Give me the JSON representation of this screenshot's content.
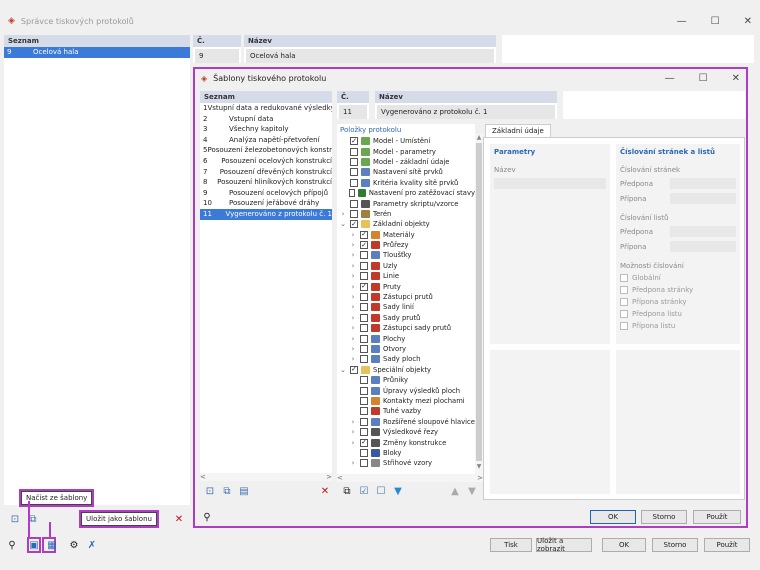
{
  "outer": {
    "title": "Správce tiskových protokolů",
    "list_header": "Seznam",
    "list_items": [
      {
        "num": "9",
        "name": "Ocelová hala"
      }
    ],
    "c_header": "Č.",
    "c_value": "9",
    "name_header": "Název",
    "name_value": "Ocelová hala",
    "buttons": {
      "print": "Tisk",
      "show": "Uložit a zobrazit",
      "ok": "OK",
      "cancel": "Storno",
      "apply": "Použít"
    }
  },
  "tooltips": {
    "load": "Načíst ze šablony",
    "save": "Uložit jako šablonu"
  },
  "inner": {
    "title": "Šablony tiskového protokolu",
    "list_header": "Seznam",
    "list_items": [
      {
        "num": "1",
        "name": "Vstupní data a redukované výsledky"
      },
      {
        "num": "2",
        "name": "Vstupní data"
      },
      {
        "num": "3",
        "name": "Všechny kapitoly"
      },
      {
        "num": "4",
        "name": "Analýza napětí-přetvoření"
      },
      {
        "num": "5",
        "name": "Posouzení železobetonových konstrukcí"
      },
      {
        "num": "6",
        "name": "Posouzení ocelových konstrukcí"
      },
      {
        "num": "7",
        "name": "Posouzení dřevěných konstrukcí"
      },
      {
        "num": "8",
        "name": "Posouzení hliníkových konstrukcí"
      },
      {
        "num": "9",
        "name": "Posouzení ocelových přípojů"
      },
      {
        "num": "10",
        "name": "Posouzení jeřábové dráhy"
      },
      {
        "num": "11",
        "name": "Vygenerováno z protokolu č. 1"
      }
    ],
    "c_header": "Č.",
    "c_value": "11",
    "name_header": "Název",
    "name_value": "Vygenerováno z protokolu č. 1",
    "items_header": "Položky protokolu",
    "tree": [
      {
        "indent": 1,
        "exp": "",
        "checked": true,
        "icon": "model-icon",
        "color": "#6aa84f",
        "label": "Model - Umístění"
      },
      {
        "indent": 1,
        "exp": "",
        "checked": false,
        "icon": "model-params-icon",
        "color": "#6aa84f",
        "label": "Model - parametry"
      },
      {
        "indent": 1,
        "exp": "",
        "checked": false,
        "icon": "model-basic-icon",
        "color": "#6aa84f",
        "label": "Model - základní údaje"
      },
      {
        "indent": 1,
        "exp": "",
        "checked": false,
        "icon": "mesh-settings-icon",
        "color": "#5b7fbf",
        "label": "Nastavení sítě prvků"
      },
      {
        "indent": 1,
        "exp": "",
        "checked": false,
        "icon": "mesh-quality-icon",
        "color": "#5b7fbf",
        "label": "Kritéria kvality sítě prvků"
      },
      {
        "indent": 1,
        "exp": "",
        "checked": false,
        "icon": "load-settings-icon",
        "color": "#2e7d32",
        "label": "Nastavení pro zatěžovací stavy"
      },
      {
        "indent": 1,
        "exp": "",
        "checked": false,
        "icon": "formula-icon",
        "color": "#555555",
        "label": "Parametry skriptu/vzorce"
      },
      {
        "indent": 1,
        "exp": ">",
        "checked": false,
        "icon": "terrain-icon",
        "color": "#a08040",
        "label": "Terén"
      },
      {
        "indent": 1,
        "exp": "v",
        "checked": true,
        "icon": "folder-icon",
        "color": "#e8c15a",
        "label": "Základní objekty"
      },
      {
        "indent": 2,
        "exp": ">",
        "checked": true,
        "icon": "materials-icon",
        "color": "#d4842a",
        "label": "Materiály"
      },
      {
        "indent": 2,
        "exp": ">",
        "checked": true,
        "icon": "sections-icon",
        "color": "#c0392b",
        "label": "Průřezy"
      },
      {
        "indent": 2,
        "exp": ">",
        "checked": false,
        "icon": "thickness-icon",
        "color": "#5b7fbf",
        "label": "Tloušťky"
      },
      {
        "indent": 2,
        "exp": ">",
        "checked": false,
        "icon": "nodes-icon",
        "color": "#c0392b",
        "label": "Uzly"
      },
      {
        "indent": 2,
        "exp": ">",
        "checked": false,
        "icon": "lines-icon",
        "color": "#c0392b",
        "label": "Linie"
      },
      {
        "indent": 2,
        "exp": ">",
        "checked": true,
        "icon": "members-icon",
        "color": "#c0392b",
        "label": "Pruty"
      },
      {
        "indent": 2,
        "exp": ">",
        "checked": false,
        "icon": "member-rep-icon",
        "color": "#c0392b",
        "label": "Zástupci prutů"
      },
      {
        "indent": 2,
        "exp": ">",
        "checked": false,
        "icon": "line-sets-icon",
        "color": "#c0392b",
        "label": "Sady linií"
      },
      {
        "indent": 2,
        "exp": ">",
        "checked": false,
        "icon": "member-sets-icon",
        "color": "#c0392b",
        "label": "Sady prutů"
      },
      {
        "indent": 2,
        "exp": ">",
        "checked": false,
        "icon": "member-set-rep-icon",
        "color": "#c0392b",
        "label": "Zástupci sady prutů"
      },
      {
        "indent": 2,
        "exp": ">",
        "checked": false,
        "icon": "surfaces-icon",
        "color": "#5b7fbf",
        "label": "Plochy"
      },
      {
        "indent": 2,
        "exp": ">",
        "checked": false,
        "icon": "openings-icon",
        "color": "#5b7fbf",
        "label": "Otvory"
      },
      {
        "indent": 2,
        "exp": ">",
        "checked": false,
        "icon": "surface-sets-icon",
        "color": "#5b7fbf",
        "label": "Sady ploch"
      },
      {
        "indent": 1,
        "exp": "v",
        "checked": true,
        "icon": "folder-icon",
        "color": "#e8c15a",
        "label": "Speciální objekty"
      },
      {
        "indent": 2,
        "exp": "",
        "checked": false,
        "icon": "intersections-icon",
        "color": "#5b7fbf",
        "label": "Průniky"
      },
      {
        "indent": 2,
        "exp": "",
        "checked": false,
        "icon": "result-adjust-icon",
        "color": "#5b7fbf",
        "label": "Úpravy výsledků ploch"
      },
      {
        "indent": 2,
        "exp": "",
        "checked": false,
        "icon": "contacts-icon",
        "color": "#d4842a",
        "label": "Kontakty mezi plochami"
      },
      {
        "indent": 2,
        "exp": "",
        "checked": false,
        "icon": "rigid-links-icon",
        "color": "#c0392b",
        "label": "Tuhé vazby"
      },
      {
        "indent": 2,
        "exp": ">",
        "checked": false,
        "icon": "column-head-icon",
        "color": "#5b7fbf",
        "label": "Rozšířené sloupové hlavice"
      },
      {
        "indent": 2,
        "exp": ">",
        "checked": false,
        "icon": "result-sections-icon",
        "color": "#555555",
        "label": "Výsledkové řezy"
      },
      {
        "indent": 2,
        "exp": ">",
        "checked": true,
        "icon": "construction-changes-icon",
        "color": "#555555",
        "label": "Změny konstrukce"
      },
      {
        "indent": 2,
        "exp": "",
        "checked": false,
        "icon": "blocks-icon",
        "color": "#3a5a9f",
        "label": "Bloky"
      },
      {
        "indent": 2,
        "exp": ">",
        "checked": false,
        "icon": "roof-patterns-icon",
        "color": "#888888",
        "label": "Střihové vzory"
      }
    ],
    "tab_label": "Základní údaje",
    "params_header": "Parametry",
    "params_name_label": "Název",
    "numbering_header": "Číslování stránek a listů",
    "page_numbering_label": "Číslování stránek",
    "prefix_label": "Předpona",
    "suffix_label": "Přípona",
    "sheet_numbering_label": "Číslování listů",
    "sheet_prefix_label": "Předpona",
    "sheet_suffix_label": "Přípona",
    "options_header": "Možnosti číslování",
    "options": [
      "Globální",
      "Předpona stránky",
      "Přípona stránky",
      "Předpona listu",
      "Přípona listu"
    ],
    "buttons": {
      "ok": "OK",
      "cancel": "Storno",
      "apply": "Použít"
    }
  },
  "colors": {
    "accent": "#b03cc6",
    "selection": "#3b7ad6",
    "header": "#d6dbe9",
    "link": "#2a6ab8"
  }
}
